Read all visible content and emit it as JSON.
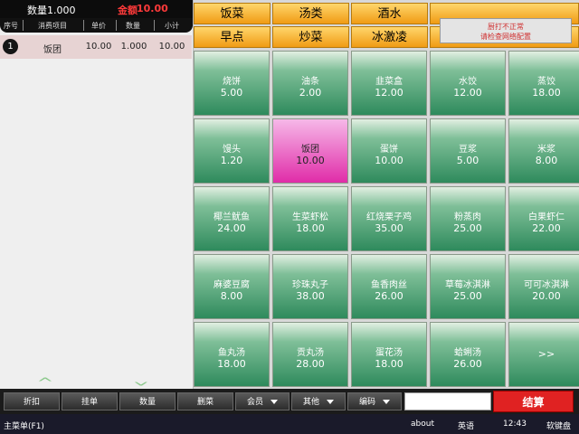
{
  "summary": {
    "qty": "数量1.000",
    "amount_label": "金额",
    "amount_value": "10.00"
  },
  "order_table": {
    "headers": [
      "序号",
      "消费项目",
      "单价",
      "数量",
      "小计"
    ],
    "rows": [
      {
        "num": "1",
        "item": "饭团",
        "price": "10.00",
        "qty": "1.000",
        "subtotal": "10.00"
      }
    ]
  },
  "categories": [
    "饭菜",
    "汤类",
    "酒水",
    "早点",
    "炒菜",
    "冰激凌"
  ],
  "notice": {
    "line1": "厨打不正常",
    "line2": "请检查网络配置"
  },
  "dishes": [
    {
      "name": "烧饼",
      "price": "5.00"
    },
    {
      "name": "油条",
      "price": "2.00"
    },
    {
      "name": "韭菜盒",
      "price": "12.00"
    },
    {
      "name": "水饺",
      "price": "12.00"
    },
    {
      "name": "蒸饺",
      "price": "18.00"
    },
    {
      "name": "馒头",
      "price": "1.20"
    },
    {
      "name": "饭团",
      "price": "10.00"
    },
    {
      "name": "蛋饼",
      "price": "10.00"
    },
    {
      "name": "豆浆",
      "price": "5.00"
    },
    {
      "name": "米浆",
      "price": "8.00"
    },
    {
      "name": "椰兰鱿鱼",
      "price": "24.00"
    },
    {
      "name": "生菜虾松",
      "price": "18.00"
    },
    {
      "name": "红烧栗子鸡",
      "price": "35.00"
    },
    {
      "name": "粉蒸肉",
      "price": "25.00"
    },
    {
      "name": "白果虾仁",
      "price": "22.00"
    },
    {
      "name": "麻婆豆腐",
      "price": "8.00"
    },
    {
      "name": "珍珠丸子",
      "price": "38.00"
    },
    {
      "name": "鱼香肉丝",
      "price": "26.00"
    },
    {
      "name": "草莓冰淇淋",
      "price": "25.00"
    },
    {
      "name": "可可冰淇淋",
      "price": "20.00"
    },
    {
      "name": "鱼丸汤",
      "price": "18.00"
    },
    {
      "name": "贡丸汤",
      "price": "28.00"
    },
    {
      "name": "蛋花汤",
      "price": "18.00"
    },
    {
      "name": "蛤蜊汤",
      "price": "26.00"
    }
  ],
  "more_label": ">>",
  "toolbar": {
    "discount": "折扣",
    "hold": "挂单",
    "quantity": "数量",
    "delete": "删菜",
    "member": "会员",
    "other": "其他",
    "code": "编码",
    "settle": "结算"
  },
  "taskbar": {
    "main": "主菜单(F1)",
    "about": "about",
    "lang": "英语",
    "time": "12:43",
    "keyboard": "软键盘"
  }
}
